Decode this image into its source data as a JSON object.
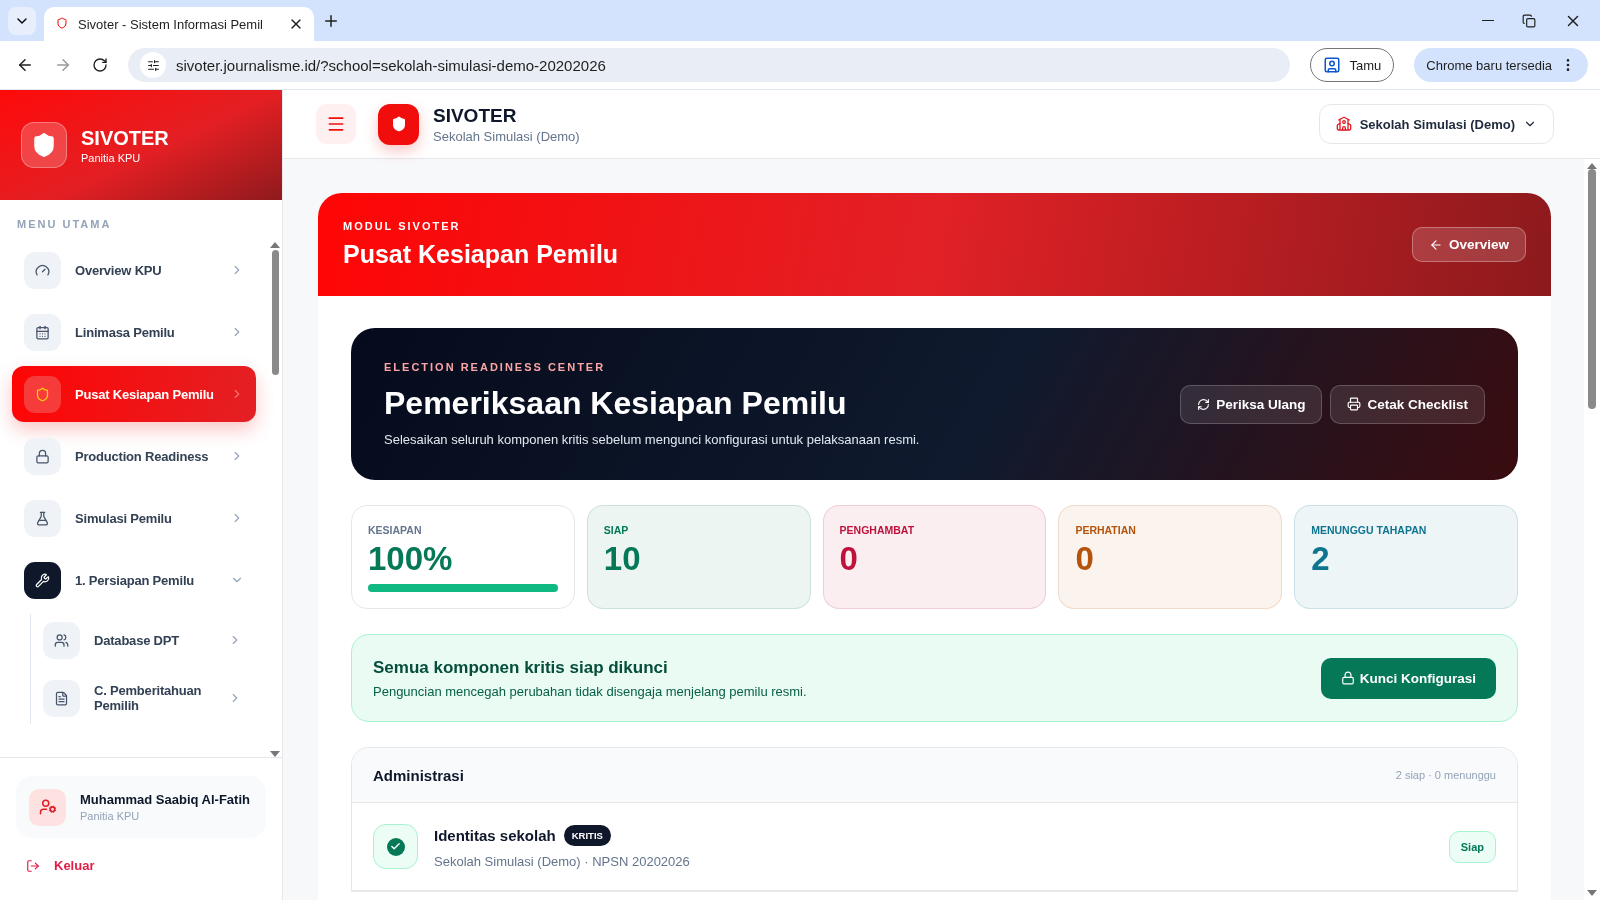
{
  "browser": {
    "tab_title": "Sivoter - Sistem Informasi Pemil",
    "url": "sivoter.journalisme.id/?school=sekolah-simulasi-demo-20202026",
    "profile": "Tamu",
    "update": "Chrome baru tersedia"
  },
  "sidebar": {
    "brand": {
      "name": "SIVOTER",
      "role": "Panitia KPU"
    },
    "section": "MENU UTAMA",
    "items": [
      {
        "label": "Overview KPU",
        "selected": false
      },
      {
        "label": "Linimasa Pemilu",
        "selected": false
      },
      {
        "label": "Pusat Kesiapan Pemilu",
        "selected": true
      },
      {
        "label": "Production Readiness",
        "selected": false
      },
      {
        "label": "Simulasi Pemilu",
        "selected": false
      },
      {
        "label": "1. Persiapan Pemilu",
        "selected": false,
        "expanded": true,
        "children": [
          {
            "label": "Database DPT",
            "selected": false
          },
          {
            "label": "C. Pemberitahuan Pemilih",
            "selected": false
          }
        ]
      }
    ],
    "user": {
      "name": "Muhammad Saabiq Al-Fatih",
      "role": "Panitia KPU"
    },
    "logout": "Keluar"
  },
  "header": {
    "title": "SIVOTER",
    "subtitle": "Sekolah Simulasi (Demo)",
    "school": "Sekolah Simulasi (Demo)"
  },
  "banner": {
    "eyebrow": "MODUL SIVOTER",
    "title": "Pusat Kesiapan Pemilu",
    "back_button": "Overview"
  },
  "hero": {
    "eyebrow": "ELECTION READINESS CENTER",
    "title": "Pemeriksaan Kesiapan Pemilu",
    "description": "Selesaikan seluruh komponen kritis sebelum mengunci konfigurasi untuk pelaksanaan resmi.",
    "buttons": [
      "Periksa Ulang",
      "Cetak Checklist"
    ]
  },
  "stats": [
    {
      "kind": "progress",
      "label": "KESIAPAN",
      "value": "100%",
      "level": 1,
      "color": "#047857"
    },
    {
      "kind": "count",
      "label": "SIAP",
      "value": "10",
      "color": "#047857"
    },
    {
      "kind": "count",
      "label": "PENGHAMBAT",
      "value": "0",
      "color": "#be123c"
    },
    {
      "kind": "count",
      "label": "PERHATIAN",
      "value": "0",
      "color": "#b45309"
    },
    {
      "kind": "count",
      "label": "MENUNGGU TAHAPAN",
      "value": "2",
      "color": "#0e7490"
    }
  ],
  "lock_notice": {
    "title": "Semua komponen kritis siap dikunci",
    "description": "Penguncian mencegah perubahan tidak disengaja menjelang pemilu resmi.",
    "button": "Kunci Konfigurasi"
  },
  "section": {
    "title": "Administrasi",
    "summary": "2 siap · 0 menunggu",
    "items": [
      {
        "title": "Identitas sekolah",
        "badge": "KRITIS",
        "subtitle": "Sekolah Simulasi (Demo) · NPSN 20202026",
        "status": "Siap",
        "checked": true
      }
    ]
  }
}
